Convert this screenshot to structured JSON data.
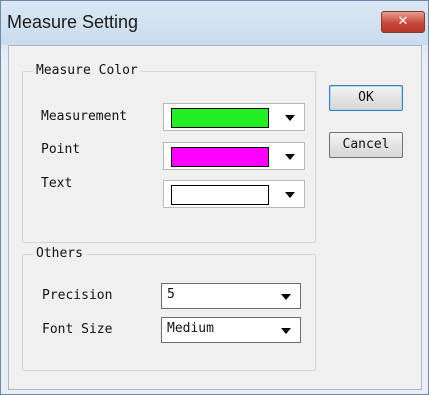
{
  "window": {
    "title": "Measure Setting",
    "close_label": "✕"
  },
  "measure_color": {
    "group_label": "Measure Color",
    "rows": [
      {
        "label": "Measurement",
        "color": "#22ee22"
      },
      {
        "label": "Point",
        "color": "#ff00ff"
      },
      {
        "label": "Text",
        "color": "#ffffff"
      }
    ]
  },
  "others": {
    "group_label": "Others",
    "precision": {
      "label": "Precision",
      "value": "5"
    },
    "font_size": {
      "label": "Font Size",
      "value": "Medium"
    }
  },
  "buttons": {
    "ok": "OK",
    "cancel": "Cancel"
  }
}
